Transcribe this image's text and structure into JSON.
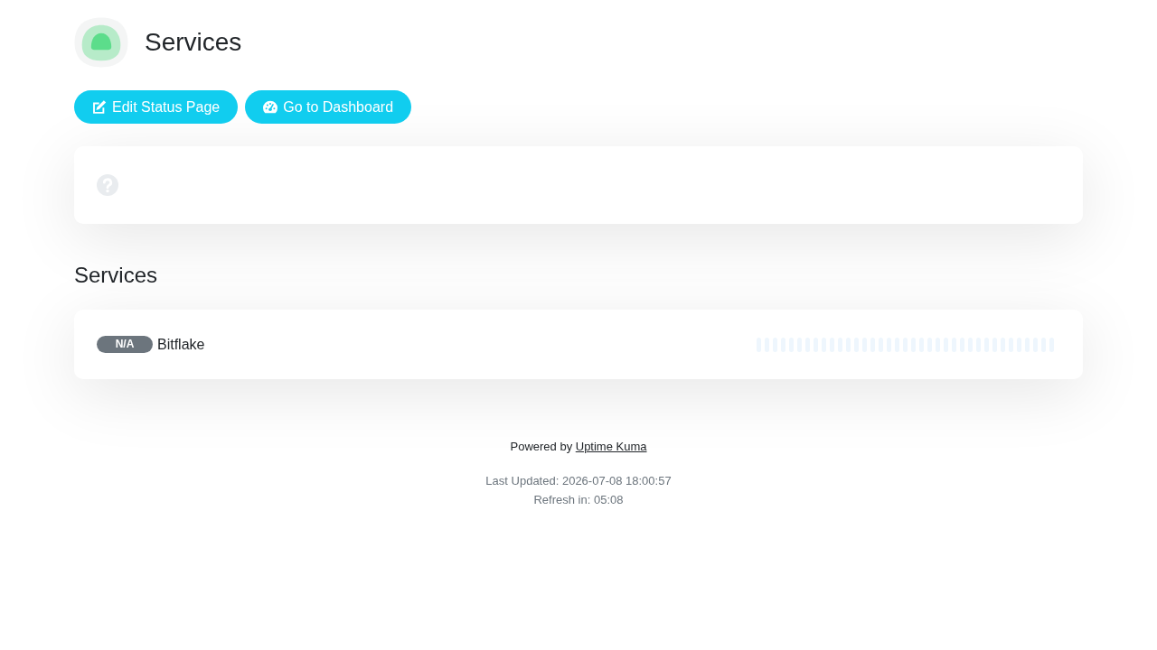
{
  "header": {
    "title": "Services"
  },
  "actions": [
    {
      "label": "Edit Status Page",
      "kind": "edit"
    },
    {
      "label": "Go to Dashboard",
      "kind": "dashboard"
    }
  ],
  "overall_status": {
    "kind": "unknown"
  },
  "groups": [
    {
      "title": "Services",
      "monitors": [
        {
          "name": "Bitflake",
          "badge": "N/A",
          "kind": "unknown"
        }
      ]
    }
  ],
  "footer": {
    "powered_by": "Powered by",
    "link": "Uptime Kuma",
    "last_updated": "Last Updated: 2026-07-08 18:00:57",
    "refresh": "Refresh in: 05:08"
  }
}
